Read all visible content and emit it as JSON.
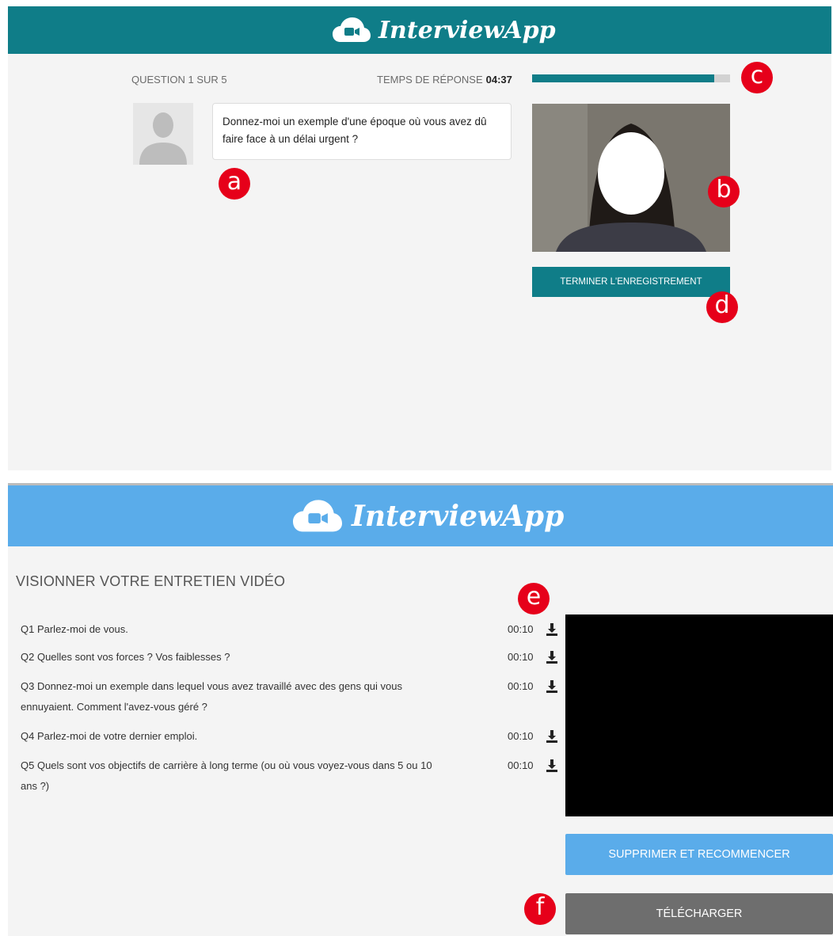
{
  "panel1": {
    "brand": "InterviewApp",
    "question_counter": "QUESTION 1 SUR 5",
    "timer_label": "TEMPS DE RÉPONSE",
    "timer_value": "04:37",
    "progress_fraction": 0.92,
    "question_text": "Donnez-moi un exemple d'une époque où vous avez dû faire face à un délai urgent ?",
    "stop_button": "TERMINER L'ENREGISTREMENT",
    "colors": {
      "header": "#0f7d88",
      "accent": "#0f7d88"
    }
  },
  "panel2": {
    "brand": "InterviewApp",
    "title": "VISIONNER VOTRE ENTRETIEN VIDÉO",
    "questions": [
      {
        "text": "Q1 Parlez-moi de vous.",
        "duration": "00:10"
      },
      {
        "text": "Q2 Quelles sont vos forces ? Vos faiblesses ?",
        "duration": "00:10"
      },
      {
        "text": "Q3 Donnez-moi un exemple dans lequel vous avez travaillé avec des gens qui vous ennuyaient. Comment l'avez-vous géré ?",
        "duration": "00:10"
      },
      {
        "text": "Q4 Parlez-moi de votre dernier emploi.",
        "duration": "00:10"
      },
      {
        "text": "Q5 Quels sont vos objectifs de carrière à long terme (ou où vous voyez-vous dans 5 ou 10 ans ?)",
        "duration": "00:10"
      }
    ],
    "delete_button": "SUPPRIMER ET RECOMMENCER",
    "download_button": "TÉLÉCHARGER",
    "colors": {
      "header": "#5aacea",
      "delete": "#5aacea",
      "download": "#6e6e6e"
    }
  },
  "markers": [
    "a",
    "b",
    "c",
    "d",
    "e",
    "f"
  ]
}
